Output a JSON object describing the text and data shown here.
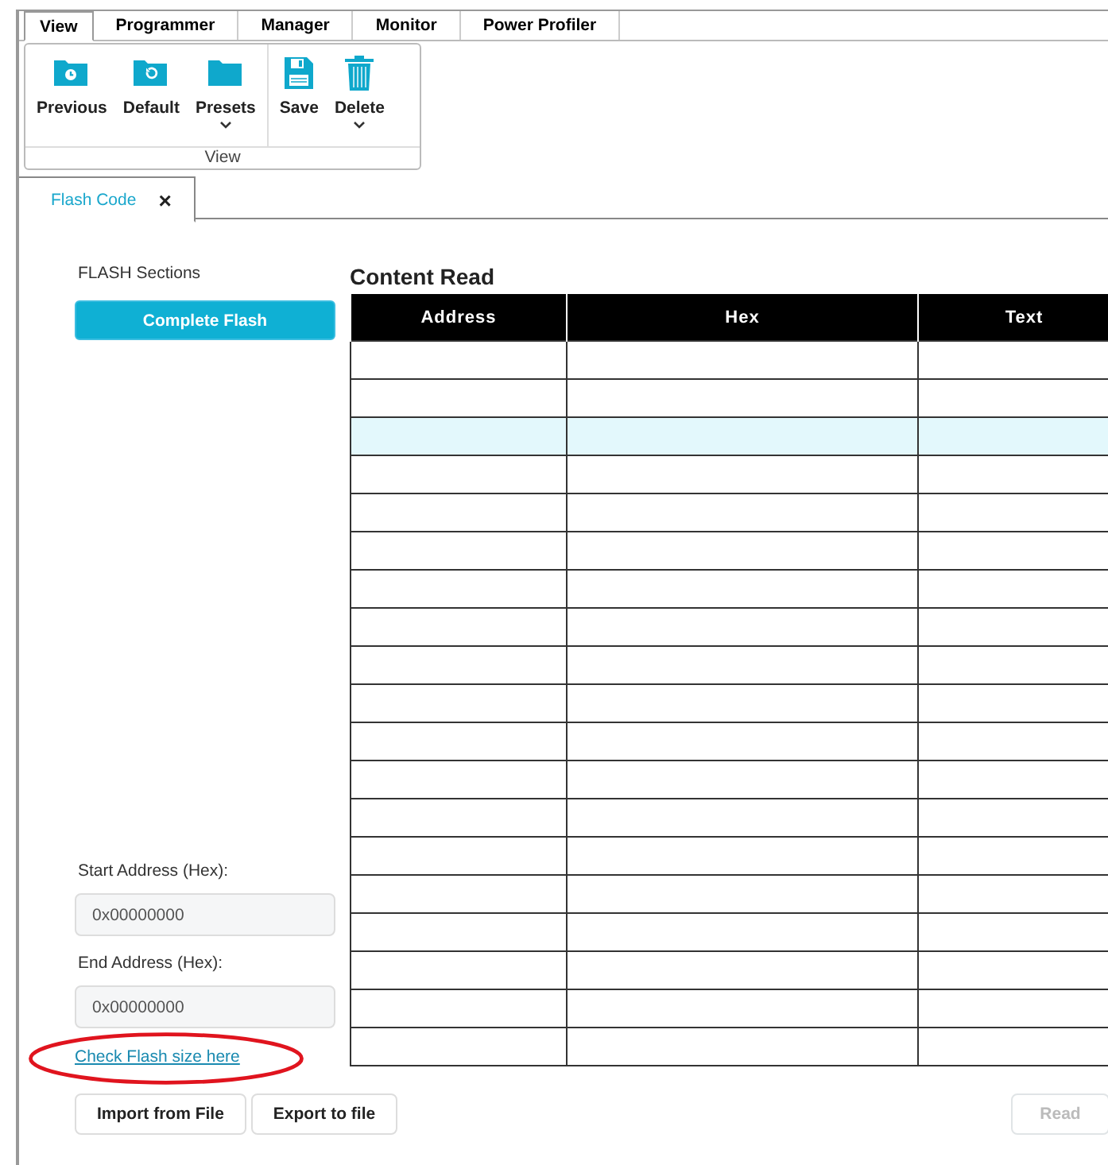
{
  "menu_tabs": [
    {
      "label": "View",
      "selected": true
    },
    {
      "label": "Programmer",
      "selected": false
    },
    {
      "label": "Manager",
      "selected": false
    },
    {
      "label": "Monitor",
      "selected": false
    },
    {
      "label": "Power Profiler",
      "selected": false
    }
  ],
  "ribbon": {
    "groups": [
      {
        "buttons": [
          {
            "label": "Previous",
            "has_menu": false
          },
          {
            "label": "Default",
            "has_menu": false
          },
          {
            "label": "Presets",
            "has_menu": true
          }
        ]
      },
      {
        "buttons": [
          {
            "label": "Save",
            "has_menu": false
          },
          {
            "label": "Delete",
            "has_menu": true
          }
        ]
      }
    ],
    "caption": "View"
  },
  "doc_tabs": [
    {
      "label": "Flash Code",
      "selected": true,
      "close": "×"
    }
  ],
  "sections": {
    "label": "FLASH Sections",
    "buttons": [
      {
        "label": "Complete Flash",
        "selected": true
      }
    ]
  },
  "start_address": {
    "label": "Start Address (Hex):",
    "placeholder": "0x00000000"
  },
  "end_address": {
    "label": "End Address (Hex):",
    "placeholder": "0x00000000"
  },
  "link": {
    "label": "Check Flash size here",
    "circled": true
  },
  "file_buttons": [
    "Import from File",
    "Export to file"
  ],
  "read_button": {
    "label": "Read",
    "disabled": true
  },
  "table": {
    "title": "Content Read",
    "columns": [
      "Address",
      "Hex",
      "Text"
    ],
    "rows": [
      {
        "selected": false
      },
      {
        "selected": false
      },
      {
        "selected": true
      },
      {
        "selected": false
      },
      {
        "selected": false
      },
      {
        "selected": false
      },
      {
        "selected": false
      },
      {
        "selected": false
      },
      {
        "selected": false
      },
      {
        "selected": false
      },
      {
        "selected": false
      },
      {
        "selected": false
      },
      {
        "selected": false
      },
      {
        "selected": false
      },
      {
        "selected": false
      },
      {
        "selected": false
      },
      {
        "selected": false
      },
      {
        "selected": false
      },
      {
        "selected": false
      }
    ]
  }
}
